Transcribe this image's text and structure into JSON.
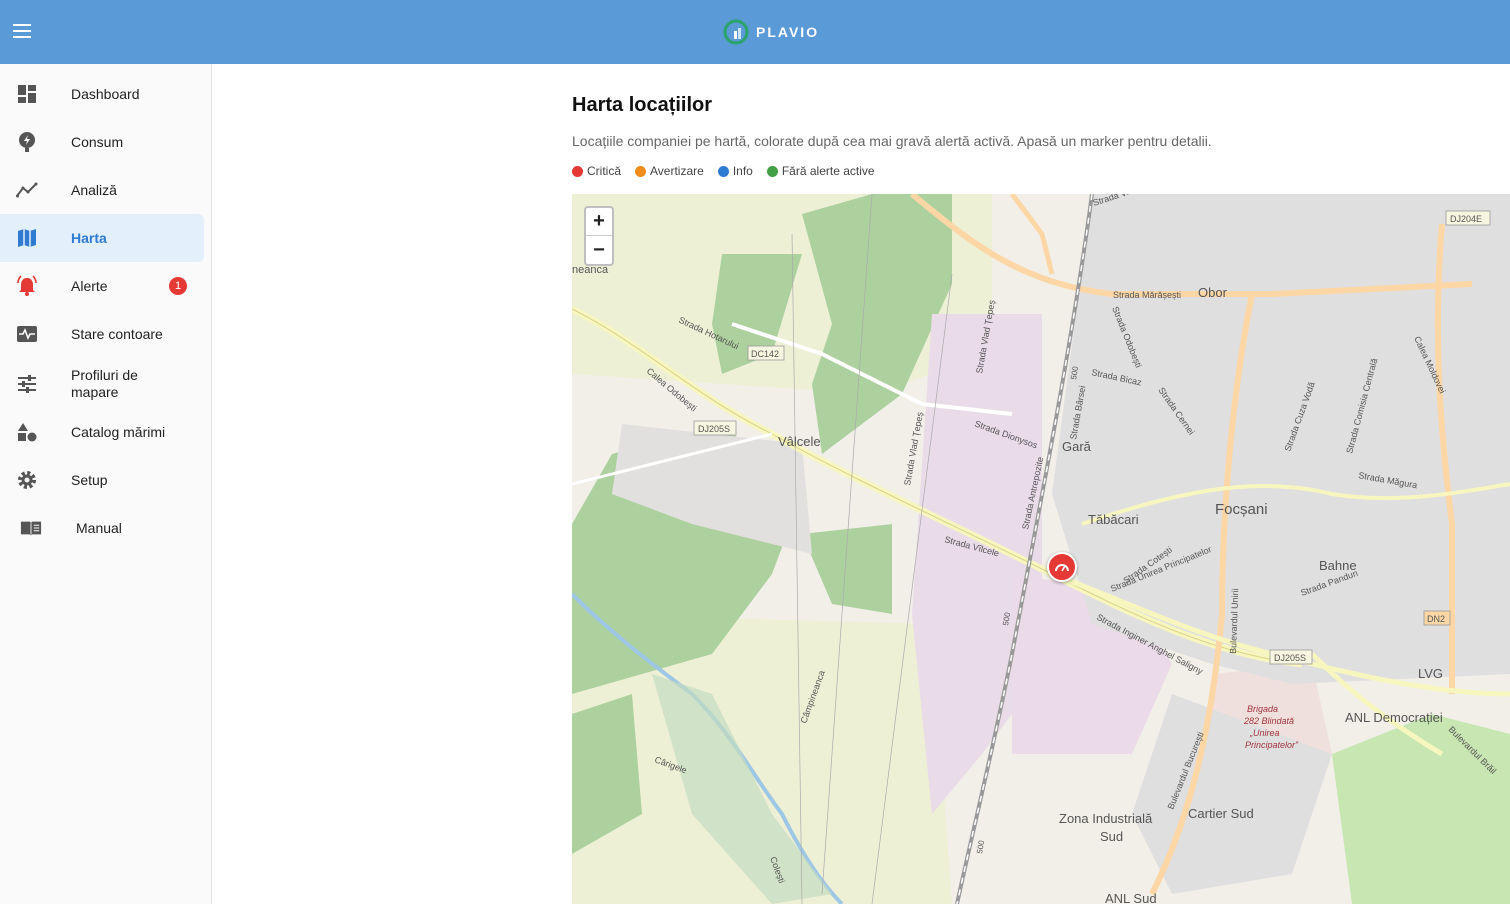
{
  "header": {
    "brand": "PLAVIO"
  },
  "sidebar": {
    "items": [
      {
        "label": "Dashboard",
        "icon": "dashboard-icon"
      },
      {
        "label": "Consum",
        "icon": "consum-icon"
      },
      {
        "label": "Analiză",
        "icon": "analytics-icon"
      },
      {
        "label": "Harta",
        "icon": "map-icon",
        "active": true
      },
      {
        "label": "Alerte",
        "icon": "bell-alert-icon",
        "badge": "1"
      },
      {
        "label": "Stare contoare",
        "icon": "monitor-heart-icon"
      },
      {
        "label": "Profiluri de mapare",
        "icon": "tune-icon"
      },
      {
        "label": "Catalog mărimi",
        "icon": "category-icon"
      },
      {
        "label": "Setup",
        "icon": "gear-icon"
      },
      {
        "label": "Manual",
        "icon": "book-icon"
      }
    ]
  },
  "main": {
    "title": "Harta locațiilor",
    "description": "Locațiile companiei pe hartă, colorate după cea mai gravă alertă activă. Apasă un marker pentru detalii.",
    "legend": [
      {
        "label": "Critică",
        "color": "#e53935"
      },
      {
        "label": "Avertizare",
        "color": "#f28c1b"
      },
      {
        "label": "Info",
        "color": "#2f7bd1"
      },
      {
        "label": "Fără alerte active",
        "color": "#43a047"
      }
    ]
  },
  "map": {
    "zoom_in": "+",
    "zoom_out": "−",
    "labels": {
      "obor": "Obor",
      "valcele": "Vâlcele",
      "gara": "Gară",
      "tabacari": "Tăbăcari",
      "focsani": "Focșani",
      "bahne": "Bahne",
      "lvg": "LVG",
      "anl_democratiei": "ANL Democrației",
      "cartier_sud": "Cartier Sud",
      "zona_ind_1": "Zona Industrială",
      "zona_ind_2": "Sud",
      "anl_sud": "ANL Sud",
      "neanca": "neanca",
      "brigada_1": "Brigada",
      "brigada_2": "282 Blindată",
      "brigada_3": "„Unirea",
      "brigada_4": "Principatelor”",
      "carigele": "Cârigele",
      "campineanca": "Câmpineanca",
      "coresti": "Colești",
      "road_dc142": "DC142",
      "road_dj205s_1": "DJ205S",
      "road_dj205s_2": "DJ205S",
      "road_dj204e": "DJ204E",
      "road_dn2": "DN2",
      "str_vrancei": "Strada Vrancei",
      "str_marasesti": "Strada Mărășești",
      "str_hotarului": "Strada Hotarului",
      "calea_odobesti": "Calea Odobești",
      "str_vlad_1": "Strada Vlad Țepeș",
      "str_vlad_2": "Strada Vlad Țepeș",
      "str_dionysos": "Strada Dionysos",
      "str_vilcele": "Strada Vîlcele",
      "str_antrepozite": "Strada Antrepozite",
      "str_barsei": "Strada Bârsei",
      "str_odobesti": "Strada Odobești",
      "str_bicaz": "Strada Bicaz",
      "str_cernei": "Strada Cernei",
      "str_cuza": "Strada Cuza Vodă",
      "str_comisia": "Strada Comisia Centrală",
      "calea_moldovei": "Calea Moldovei",
      "str_magura": "Strada Măgura",
      "str_cotesti": "Strada Cotești",
      "str_unirea": "Strada Unirea Principatelor",
      "str_saligny": "Strada Inginer Anghel Saligny",
      "bd_unirii": "Bulevardul Unirii",
      "bd_bucuresti_1": "Bulevardul București",
      "bd_bucuresti_2": "Bulevardul Brăil",
      "str_pandun": "Strada Pandun",
      "num_500a": "500",
      "num_500b": "500",
      "num_500c": "500"
    }
  }
}
